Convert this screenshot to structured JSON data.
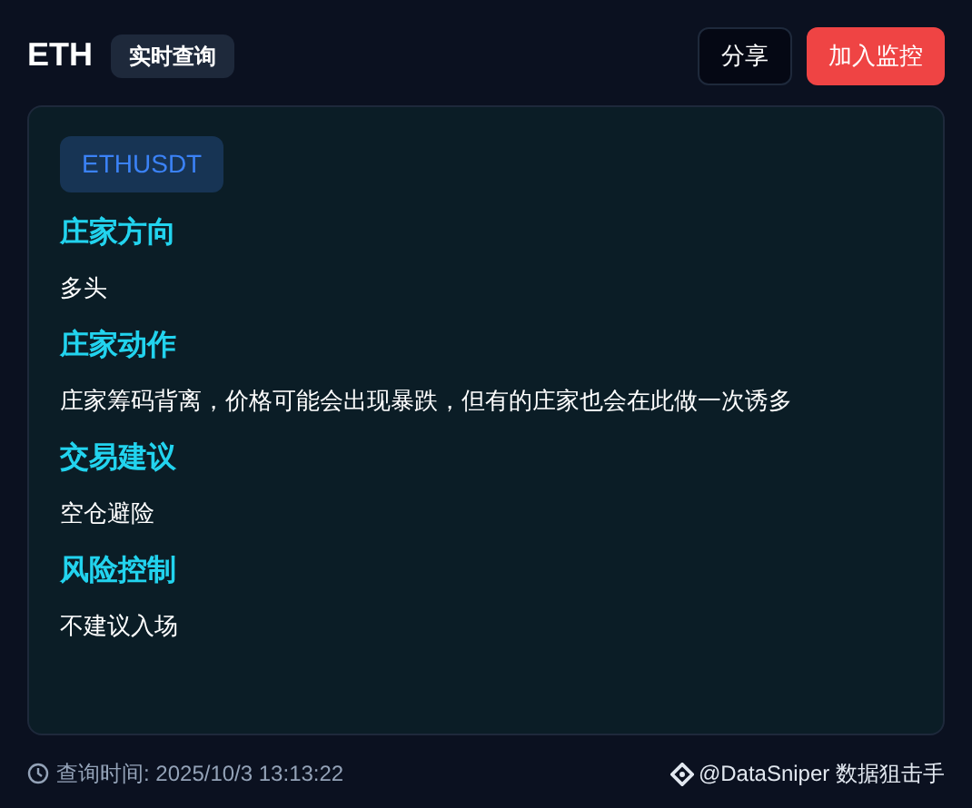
{
  "header": {
    "title": "ETH",
    "badge": "实时查询",
    "buttons": [
      {
        "kind": "secondary",
        "label": "分享"
      },
      {
        "kind": "primary",
        "label": "加入监控"
      }
    ]
  },
  "card": {
    "symbol": "ETHUSDT",
    "sections": [
      {
        "heading": "庄家方向",
        "text": "多头"
      },
      {
        "heading": "庄家动作",
        "text": "庄家筹码背离，价格可能会出现暴跌，但有的庄家也会在此做一次诱多"
      },
      {
        "heading": "交易建议",
        "text": "空仓避险"
      },
      {
        "heading": "风险控制",
        "text": "不建议入场"
      }
    ]
  },
  "footer": {
    "time": "查询时间: 2025/10/3 13:13:22",
    "brand": "@DataSniper 数据狙击手"
  }
}
